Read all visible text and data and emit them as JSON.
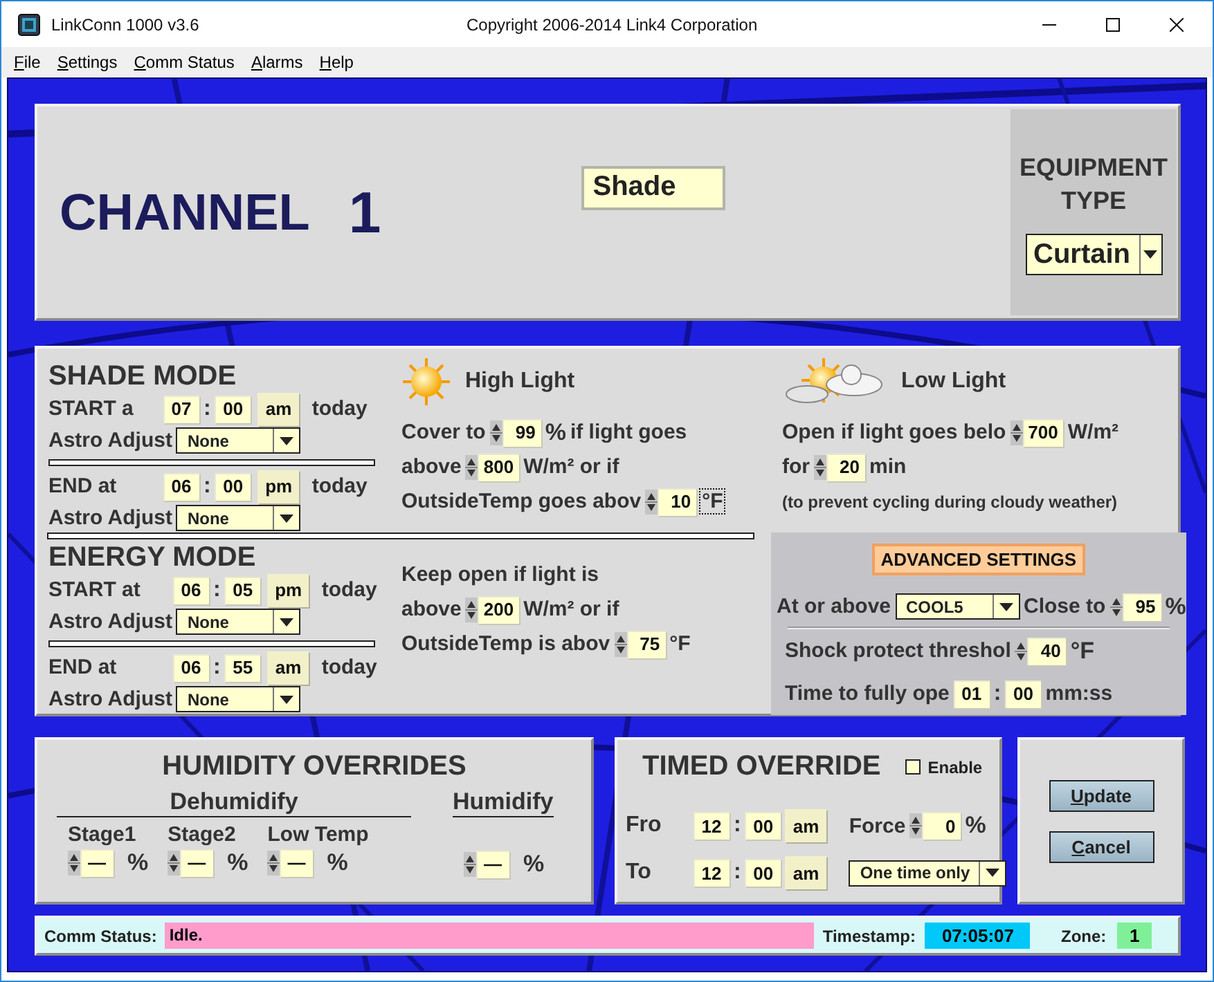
{
  "window": {
    "title": "LinkConn 1000 v3.6",
    "caption": "Copyright 2006-2014 Link4 Corporation"
  },
  "menu": [
    "File",
    "Settings",
    "Comm Status",
    "Alarms",
    "Help"
  ],
  "channel": {
    "label": "CHANNEL",
    "number": "1",
    "name": "Shade"
  },
  "equipment": {
    "label": "EQUIPMENT TYPE",
    "value": "Curtain"
  },
  "shade_mode": {
    "title": "SHADE MODE",
    "start": [
      {
        "parts": [
          {
            "kind": "label",
            "text": "START a"
          },
          {
            "kind": "field",
            "value": "07"
          },
          {
            "kind": "sep",
            "text": ":"
          },
          {
            "kind": "field",
            "value": "00"
          },
          {
            "kind": "ampm",
            "value": "am"
          },
          {
            "kind": "text",
            "text": "today"
          }
        ]
      },
      {
        "parts": [
          {
            "kind": "label",
            "text": "Astro Adjust"
          },
          {
            "kind": "select",
            "value": "None"
          }
        ]
      }
    ],
    "end": [
      {
        "parts": [
          {
            "kind": "label",
            "text": "END at"
          },
          {
            "kind": "field",
            "value": "06"
          },
          {
            "kind": "sep",
            "text": ":"
          },
          {
            "kind": "field",
            "value": "00"
          },
          {
            "kind": "ampm",
            "value": "pm"
          },
          {
            "kind": "text",
            "text": "today"
          }
        ]
      },
      {
        "parts": [
          {
            "kind": "label",
            "text": "Astro Adjust"
          },
          {
            "kind": "select",
            "value": "None"
          }
        ]
      }
    ]
  },
  "high_light": {
    "title": "High Light",
    "lines": [
      {
        "parts": [
          {
            "kind": "text",
            "text": "Cover to"
          },
          {
            "kind": "spin",
            "value": "99"
          },
          {
            "kind": "unit",
            "text": "%"
          },
          {
            "kind": "text",
            "text": "if light goes"
          }
        ]
      },
      {
        "parts": [
          {
            "kind": "text",
            "text": "above"
          },
          {
            "kind": "spin",
            "value": "800"
          },
          {
            "kind": "text",
            "text": "W/m² or if"
          }
        ]
      },
      {
        "parts": [
          {
            "kind": "text",
            "text": "OutsideTemp goes abov"
          },
          {
            "kind": "spin",
            "value": "10"
          },
          {
            "kind": "text",
            "text": "°F",
            "focused": true
          }
        ]
      }
    ]
  },
  "low_light": {
    "title": "Low Light",
    "lines": [
      {
        "parts": [
          {
            "kind": "text",
            "text": "Open if light goes belo"
          },
          {
            "kind": "spin",
            "value": "700"
          },
          {
            "kind": "text",
            "text": "W/m²"
          }
        ]
      },
      {
        "parts": [
          {
            "kind": "text",
            "text": "for"
          },
          {
            "kind": "spin",
            "value": "20"
          },
          {
            "kind": "text",
            "text": "min"
          }
        ]
      },
      {
        "parts": [
          {
            "kind": "note",
            "text": "(to prevent cycling during cloudy weather)"
          }
        ]
      }
    ]
  },
  "energy_mode": {
    "title": "ENERGY MODE",
    "start": [
      {
        "parts": [
          {
            "kind": "label",
            "text": "START at"
          },
          {
            "kind": "field",
            "value": "06"
          },
          {
            "kind": "sep",
            "text": ":"
          },
          {
            "kind": "field",
            "value": "05"
          },
          {
            "kind": "ampm",
            "value": "pm"
          },
          {
            "kind": "text",
            "text": "today"
          }
        ]
      },
      {
        "parts": [
          {
            "kind": "label",
            "text": "Astro Adjust"
          },
          {
            "kind": "select",
            "value": "None"
          }
        ]
      }
    ],
    "end": [
      {
        "parts": [
          {
            "kind": "label",
            "text": "END at"
          },
          {
            "kind": "field",
            "value": "06"
          },
          {
            "kind": "sep",
            "text": ":"
          },
          {
            "kind": "field",
            "value": "55"
          },
          {
            "kind": "ampm",
            "value": "am"
          },
          {
            "kind": "text",
            "text": "today"
          }
        ]
      },
      {
        "parts": [
          {
            "kind": "label",
            "text": "Astro Adjust"
          },
          {
            "kind": "select",
            "value": "None"
          }
        ]
      }
    ],
    "lines": [
      {
        "parts": [
          {
            "kind": "text",
            "text": "Keep open if light is"
          }
        ]
      },
      {
        "parts": [
          {
            "kind": "text",
            "text": "above"
          },
          {
            "kind": "spin",
            "value": "200"
          },
          {
            "kind": "text",
            "text": "W/m² or if"
          }
        ]
      },
      {
        "parts": [
          {
            "kind": "text",
            "text": "OutsideTemp is abov"
          },
          {
            "kind": "spin",
            "value": "75"
          },
          {
            "kind": "text",
            "text": "°F"
          }
        ]
      }
    ]
  },
  "advanced": {
    "button": "ADVANCED SETTINGS",
    "top": [
      {
        "parts": [
          {
            "kind": "text",
            "text": "At or above"
          },
          {
            "kind": "select",
            "value": "COOL5"
          },
          {
            "kind": "text",
            "text": "Close to"
          },
          {
            "kind": "spin",
            "value": "95"
          },
          {
            "kind": "unit",
            "text": "%"
          }
        ]
      }
    ],
    "bottom": [
      {
        "parts": [
          {
            "kind": "text",
            "text": "Shock protect threshol"
          },
          {
            "kind": "spin",
            "value": "40"
          },
          {
            "kind": "unit",
            "text": "°F"
          }
        ]
      },
      {
        "parts": [
          {
            "kind": "text",
            "text": "Time to fully ope"
          },
          {
            "kind": "field",
            "value": "01"
          },
          {
            "kind": "sep",
            "text": ":"
          },
          {
            "kind": "field",
            "value": "00"
          },
          {
            "kind": "text",
            "text": "mm:ss"
          }
        ]
      }
    ]
  },
  "humidity": {
    "title": "HUMIDITY OVERRIDES",
    "dehumidify": "Dehumidify",
    "humidify": "Humidify",
    "stages": [
      {
        "label": "Stage1",
        "value": "—",
        "unit": "%"
      },
      {
        "label": "Stage2",
        "value": "—",
        "unit": "%"
      },
      {
        "label": "Low Temp",
        "value": "—",
        "unit": "%"
      }
    ],
    "humidify_stage": {
      "value": "—",
      "unit": "%"
    }
  },
  "timed": {
    "title": "TIMED OVERRIDE",
    "enable": {
      "label": "Enable",
      "checked": false
    },
    "lines": [
      {
        "parts": [
          {
            "kind": "label",
            "text": "Fro"
          },
          {
            "kind": "field",
            "value": "12"
          },
          {
            "kind": "sep",
            "text": ":"
          },
          {
            "kind": "field",
            "value": "00"
          },
          {
            "kind": "ampm",
            "value": "am"
          }
        ]
      },
      {
        "parts": [
          {
            "kind": "label",
            "text": "To"
          },
          {
            "kind": "field",
            "value": "12"
          },
          {
            "kind": "sep",
            "text": ":"
          },
          {
            "kind": "field",
            "value": "00"
          },
          {
            "kind": "ampm",
            "value": "am"
          }
        ]
      }
    ],
    "side": [
      {
        "parts": [
          {
            "kind": "text",
            "text": "Force"
          },
          {
            "kind": "spin",
            "value": "0"
          },
          {
            "kind": "unit",
            "text": "%"
          }
        ]
      },
      {
        "parts": [
          {
            "kind": "select",
            "value": "One time only"
          }
        ]
      }
    ]
  },
  "buttons": [
    "Update",
    "Cancel"
  ],
  "status": {
    "label": "Comm Status:",
    "value": "Idle.",
    "timestamp_label": "Timestamp:",
    "timestamp": "07:05:07",
    "zone_label": "Zone:",
    "zone": "1"
  }
}
